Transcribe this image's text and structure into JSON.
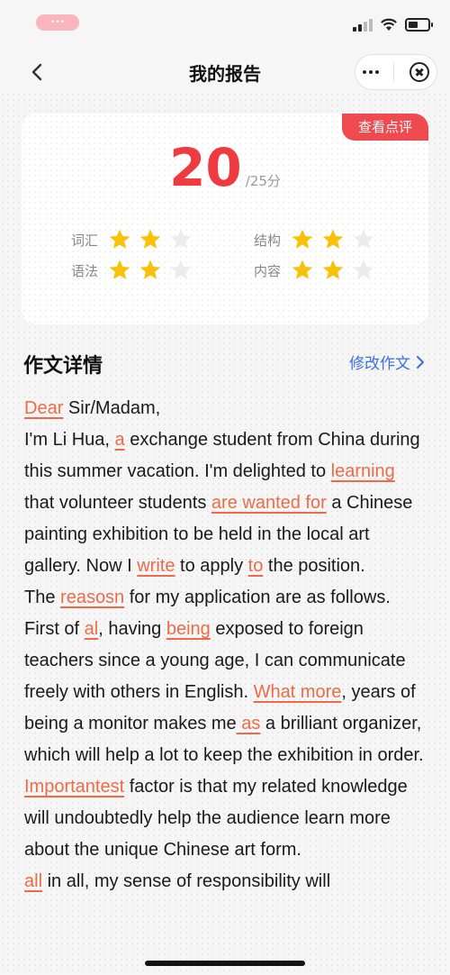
{
  "status_bar": {
    "pill_text": "•••"
  },
  "nav": {
    "title": "我的报告"
  },
  "score_card": {
    "review_button": "查看点评",
    "score": "20",
    "total": "/25分",
    "ratings": [
      {
        "label": "词汇",
        "filled": 2,
        "max": 3
      },
      {
        "label": "结构",
        "filled": 2,
        "max": 3
      },
      {
        "label": "语法",
        "filled": 2,
        "max": 3
      },
      {
        "label": "内容",
        "filled": 2,
        "max": 3
      }
    ]
  },
  "essay": {
    "section_title": "作文详情",
    "edit_link": "修改作文",
    "paragraphs": [
      [
        {
          "t": "Dear",
          "e": true
        },
        {
          "t": " Sir/Madam,"
        }
      ],
      [
        {
          "t": "I'm Li Hua, "
        },
        {
          "t": "a",
          "e": true
        },
        {
          "t": " exchange student from China during this summer vacation. I'm delighted to "
        },
        {
          "t": "learning",
          "e": true
        },
        {
          "t": " that volunteer students "
        },
        {
          "t": "are wanted for",
          "e": true
        },
        {
          "t": " a Chinese painting exhibition to be held in the local art gallery. Now I "
        },
        {
          "t": "write",
          "e": true
        },
        {
          "t": " to apply "
        },
        {
          "t": "to",
          "e": true
        },
        {
          "t": " the position."
        }
      ],
      [
        {
          "t": "The "
        },
        {
          "t": "reasosn",
          "e": true
        },
        {
          "t": " for my application are as follows. First of "
        },
        {
          "t": "al",
          "e": true
        },
        {
          "t": ", having "
        },
        {
          "t": "being",
          "e": true
        },
        {
          "t": " exposed to foreign teachers since a young age, I can communicate freely with others in English. "
        },
        {
          "t": "What more",
          "e": true
        },
        {
          "t": ", years of being a monitor makes me"
        },
        {
          "t": " as",
          "e": true
        },
        {
          "t": " a brilliant organizer, which will help a lot to keep the exhibition in order. "
        },
        {
          "t": "Importantest",
          "e": true
        },
        {
          "t": " factor is that my related knowledge will undoubtedly help the audience learn more about the unique Chinese art form."
        }
      ],
      [
        {
          "t": "all",
          "e": true
        },
        {
          "t": " in all, my sense of responsibility will"
        }
      ]
    ]
  },
  "colors": {
    "accent_red": "#ef3a40",
    "error_orange": "#ee6b48",
    "link_blue": "#3b6fe0",
    "star_gold": "#f8c20b"
  }
}
